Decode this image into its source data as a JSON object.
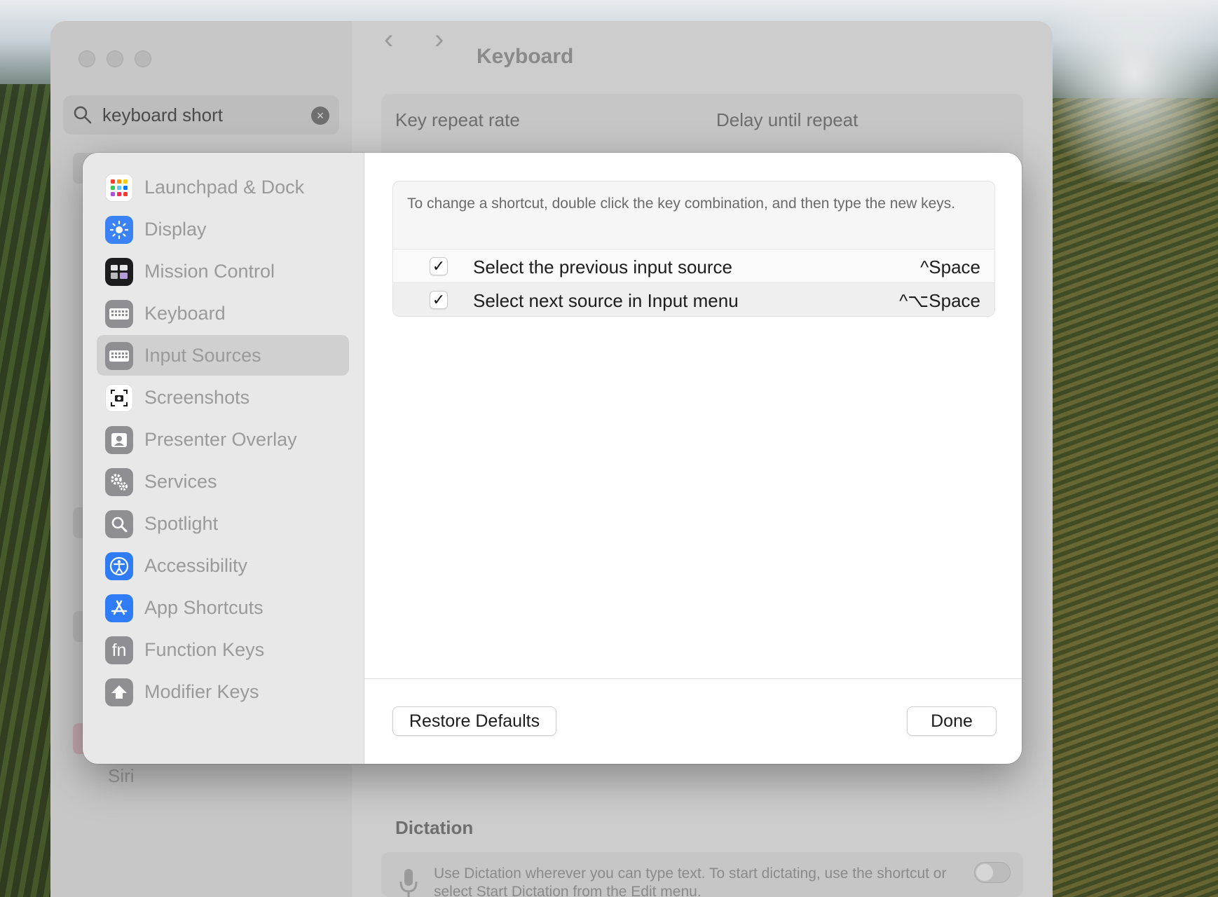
{
  "search": {
    "value": "keyboard short"
  },
  "window": {
    "title": "Keyboard"
  },
  "background_panel": {
    "key_repeat_label": "Key repeat rate",
    "delay_label": "Delay until repeat",
    "dictation_title": "Dictation",
    "dictation_text": "Use Dictation wherever you can type text. To start dictating, use the shortcut or select Start Dictation from the Edit menu.",
    "siri_label": "Siri"
  },
  "categories": [
    {
      "label": "Launchpad & Dock",
      "icon": "launchpad-icon",
      "color": "#ffffff"
    },
    {
      "label": "Display",
      "icon": "display-icon",
      "color": "#3b82f6"
    },
    {
      "label": "Mission Control",
      "icon": "mission-control-icon",
      "color": "#1c1c1e"
    },
    {
      "label": "Keyboard",
      "icon": "keyboard-icon",
      "color": "#8e8e93"
    },
    {
      "label": "Input Sources",
      "icon": "input-sources-icon",
      "color": "#8e8e93",
      "selected": true
    },
    {
      "label": "Screenshots",
      "icon": "screenshot-icon",
      "color": "#ffffff"
    },
    {
      "label": "Presenter Overlay",
      "icon": "presenter-overlay-icon",
      "color": "#8e8e93"
    },
    {
      "label": "Services",
      "icon": "gears-icon",
      "color": "#8e8e93"
    },
    {
      "label": "Spotlight",
      "icon": "magnifier-icon",
      "color": "#8e8e93"
    },
    {
      "label": "Accessibility",
      "icon": "accessibility-icon",
      "color": "#2f7cf6"
    },
    {
      "label": "App Shortcuts",
      "icon": "app-store-icon",
      "color": "#2f7cf6"
    },
    {
      "label": "Function Keys",
      "icon": "fn-icon",
      "color": "#8e8e93"
    },
    {
      "label": "Modifier Keys",
      "icon": "up-arrow-icon",
      "color": "#8e8e93"
    }
  ],
  "panel": {
    "hint": "To change a shortcut, double click the key combination, and then type the new keys.",
    "shortcuts": [
      {
        "label": "Select the previous input source",
        "key": "^Space",
        "checked": true
      },
      {
        "label": "Select next source in Input menu",
        "key": "^⌥Space",
        "checked": true
      }
    ]
  },
  "buttons": {
    "restore": "Restore Defaults",
    "done": "Done"
  },
  "icons": {
    "checkmark": "✓",
    "fn": "fn",
    "clear": "×",
    "back": "‹",
    "forward": "›"
  }
}
